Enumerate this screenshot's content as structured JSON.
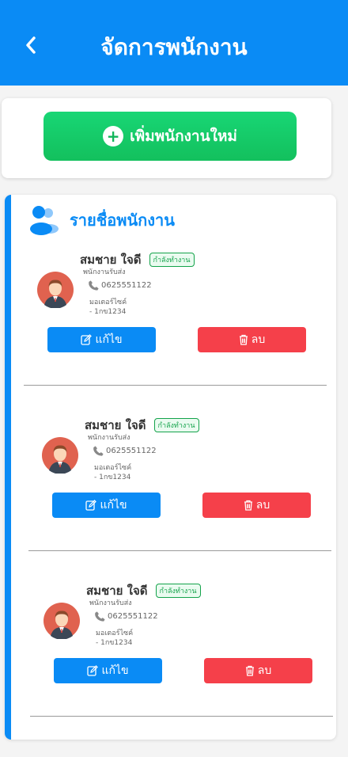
{
  "header": {
    "title": "จัดการพนักงาน",
    "back_icon": "chevron-left-icon"
  },
  "actions": {
    "add_label": "เพิ่มพนักงานใหม่",
    "add_icon": "plus-circle-icon"
  },
  "list": {
    "title": "รายชื่อพนักงาน",
    "icon": "users-icon",
    "employees": [
      {
        "name": "สมชาย ใจดี",
        "status": "กำลังทำงาน",
        "role": "พนักงานรับส่ง",
        "phone": "0625551122",
        "vehicle_line1": "มอเตอร์ไซค์",
        "vehicle_line2": "- 1กข1234",
        "edit_label": "แก้ไข",
        "delete_label": "ลบ"
      },
      {
        "name": "สมชาย ใจดี",
        "status": "กำลังทำงาน",
        "role": "พนักงานรับส่ง",
        "phone": "0625551122",
        "vehicle_line1": "มอเตอร์ไซค์",
        "vehicle_line2": "- 1กข1234",
        "edit_label": "แก้ไข",
        "delete_label": "ลบ"
      },
      {
        "name": "สมชาย ใจดี",
        "status": "กำลังทำงาน",
        "role": "พนักงานรับส่ง",
        "phone": "0625551122",
        "vehicle_line1": "มอเตอร์ไซค์",
        "vehicle_line2": "- 1กข1234",
        "edit_label": "แก้ไข",
        "delete_label": "ลบ"
      }
    ]
  },
  "colors": {
    "primary": "#0a8bf5",
    "success": "#13c05d",
    "danger": "#f5404a"
  }
}
